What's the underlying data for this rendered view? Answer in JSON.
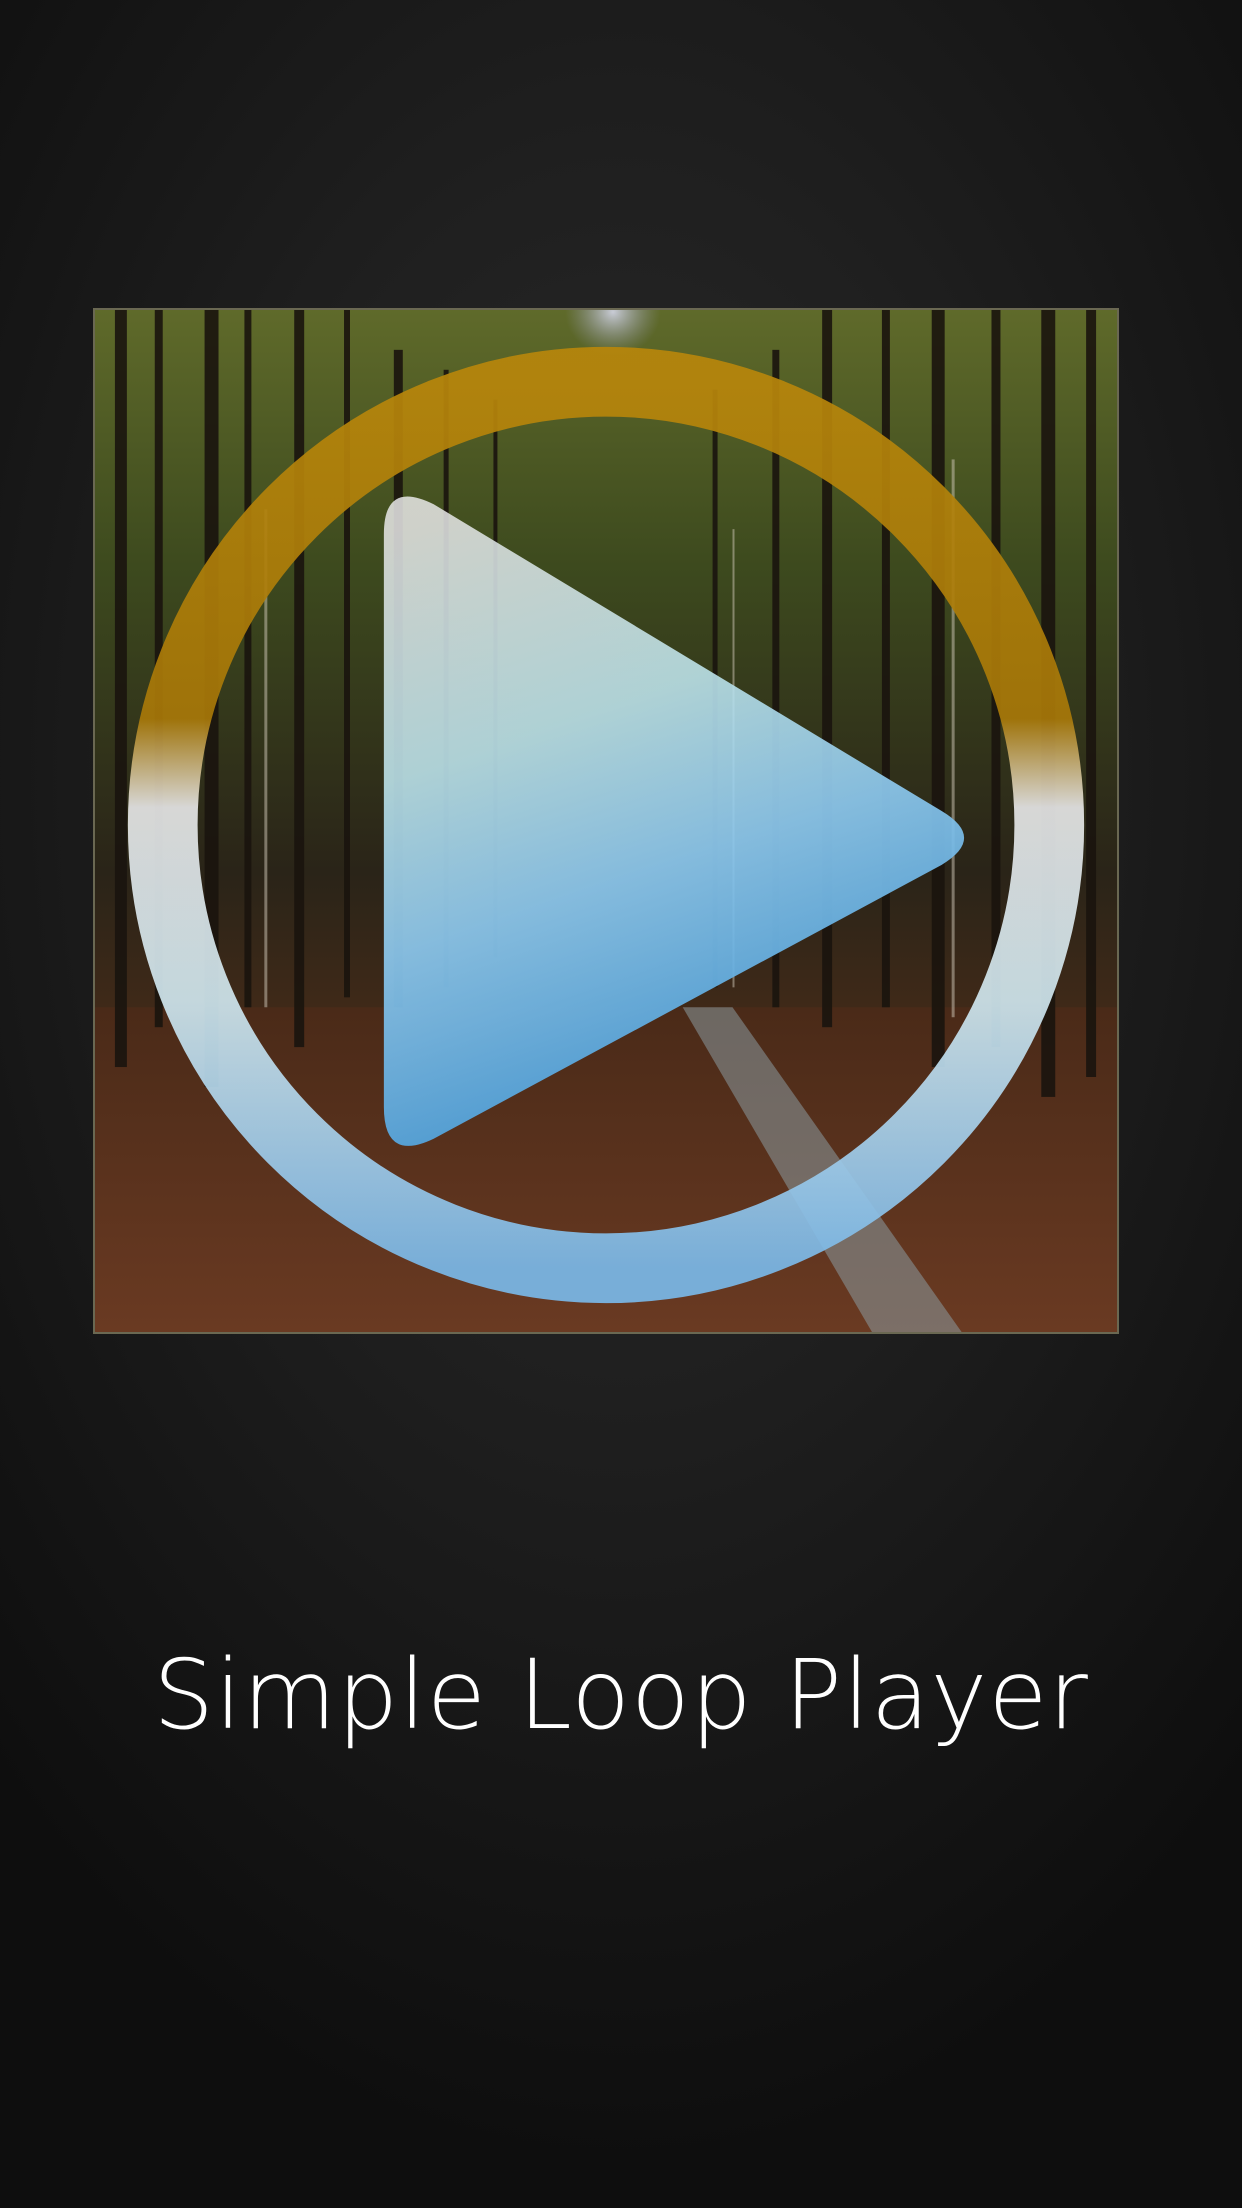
{
  "app": {
    "title": "Simple Loop Player"
  },
  "splash": {
    "artwork": "forest-path-photo",
    "icon": "play-icon"
  },
  "colors": {
    "background": "#1c1c1c",
    "ring_top": "#b8860b",
    "ring_light": "#dcdcdc",
    "ring_blue": "#7ab8e8",
    "play_blue": "#3d96d6",
    "title_text": "#ffffff"
  }
}
